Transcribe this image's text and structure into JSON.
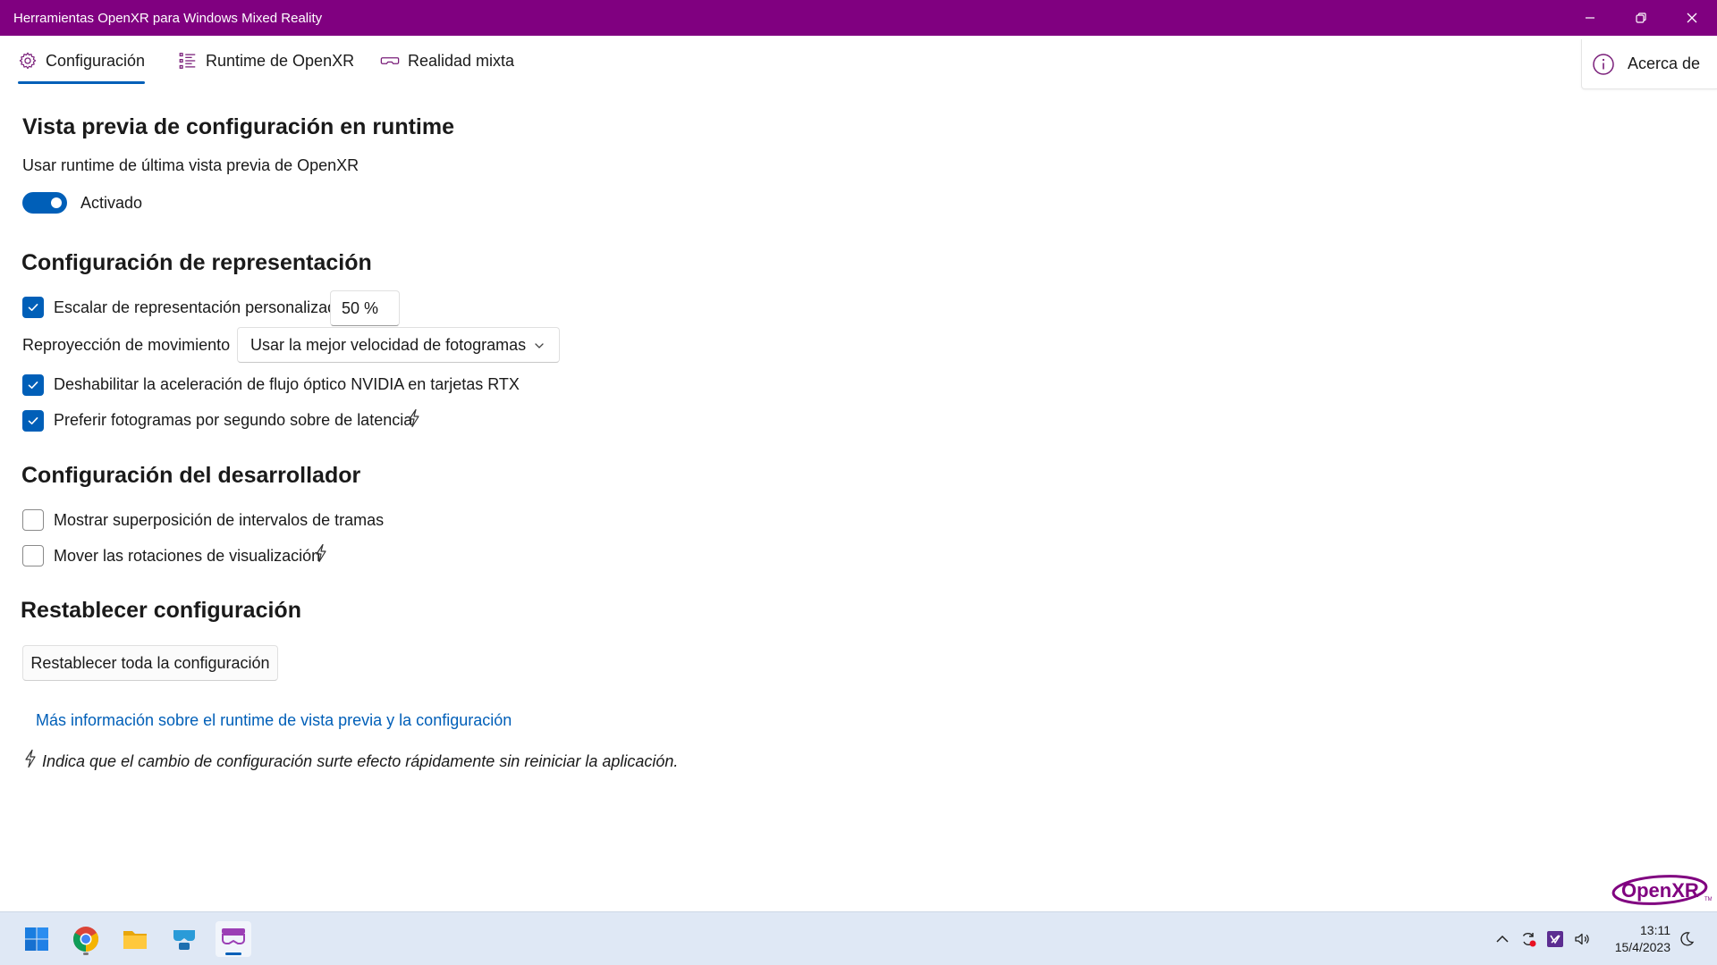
{
  "window": {
    "title": "Herramientas OpenXR para Windows Mixed Reality",
    "accent_color": "#800080"
  },
  "nav": {
    "tabs": [
      {
        "label": "Configuración",
        "icon": "gear-icon",
        "active": true
      },
      {
        "label": "Runtime de OpenXR",
        "icon": "list-icon",
        "active": false
      },
      {
        "label": "Realidad mixta",
        "icon": "vr-headset-icon",
        "active": false
      }
    ],
    "about_label": "Acerca de"
  },
  "preview": {
    "heading": "Vista previa de configuración en runtime",
    "description": "Usar runtime de última vista previa de OpenXR",
    "toggle_state": "Activado",
    "toggle_on": true
  },
  "render": {
    "heading": "Configuración de representación",
    "custom_scale_label": "Escalar de representación personalizada",
    "custom_scale_checked": true,
    "custom_scale_value": "50 %",
    "reprojection_label": "Reproyección de movimiento",
    "reprojection_value": "Usar la mejor velocidad de fotogramas",
    "nvidia_label": "Deshabilitar la aceleración de flujo óptico NVIDIA en tarjetas RTX",
    "nvidia_checked": true,
    "fps_label": "Preferir fotogramas por segundo sobre de latencia",
    "fps_checked": true
  },
  "developer": {
    "heading": "Configuración del desarrollador",
    "overlay_label": "Mostrar superposición de intervalos de tramas",
    "overlay_checked": false,
    "rotation_label": "Mover las rotaciones de visualización",
    "rotation_checked": false
  },
  "reset": {
    "heading": "Restablecer configuración",
    "button_label": "Restablecer toda la configuración"
  },
  "link_text": "Más información sobre el runtime de vista previa y la configuración",
  "note_text": "Indica que el cambio de configuración surte efecto rápidamente sin reiniciar la aplicación.",
  "logo_text": "OpenXR",
  "taskbar": {
    "apps": [
      "windows-start-icon",
      "chrome-icon",
      "file-explorer-icon",
      "mixed-reality-portal-icon",
      "openxr-tools-icon"
    ],
    "tray": [
      "chevron-up-icon",
      "sync-icon",
      "visual-studio-icon",
      "speaker-icon",
      "moon-icon"
    ],
    "time": "13:11",
    "date": "15/4/2023"
  },
  "colors": {
    "accent_blue": "#005fb8",
    "titlebar_purple": "#800080"
  }
}
